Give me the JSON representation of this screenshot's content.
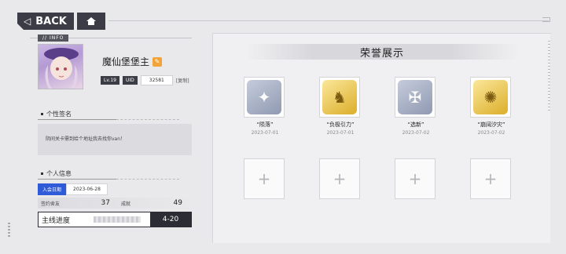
{
  "topbar": {
    "back_label": "BACK",
    "back_icon": "chevron-left-icon",
    "home_icon": "home-icon"
  },
  "profile": {
    "info_tag": "// INFO",
    "name": "魔仙堡堡主",
    "level": "Lv.19",
    "uid_label": "UID",
    "uid_value": "32581",
    "copy_label": "[复制]",
    "signature_title": "个性签名",
    "signature": "阴间关卡需到给个地址我去找你van！",
    "info_title": "个人信息",
    "join_label": "入会日期",
    "join_date": "2023-06-28",
    "stats": [
      {
        "label": "签约舍友",
        "value": "37"
      },
      {
        "label": "成就",
        "value": "49"
      }
    ],
    "progress_label": "主线进度",
    "progress_value": "4-20"
  },
  "honor": {
    "title": "荣誉展示",
    "badges": [
      {
        "name": "“陨落”",
        "date": "2023-07-01",
        "style": "silver",
        "glyph": "✦"
      },
      {
        "name": "“负极引力”",
        "date": "2023-07-01",
        "style": "gold",
        "glyph": "♞"
      },
      {
        "name": "“选新”",
        "date": "2023-07-02",
        "style": "silver",
        "glyph": "✠"
      },
      {
        "name": "“崩阔汐灾”",
        "date": "2023-07-02",
        "style": "gold",
        "glyph": "✺"
      }
    ],
    "empty_slot_symbol": "+"
  }
}
